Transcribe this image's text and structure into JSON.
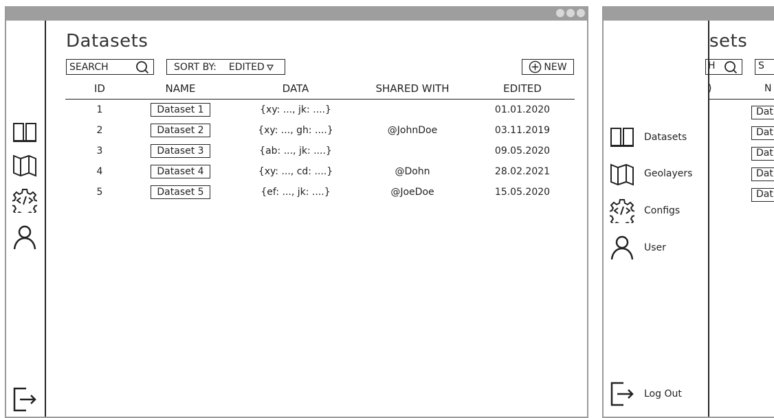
{
  "window1": {
    "title": "Datasets",
    "search_placeholder": "SEARCH",
    "sort_label": "SORT BY:",
    "sort_value": "EDITED",
    "new_label": "NEW",
    "columns": [
      "ID",
      "NAME",
      "DATA",
      "SHARED WITH",
      "EDITED"
    ],
    "rows": [
      {
        "id": "1",
        "name": "Dataset 1",
        "data": "{xy: ..., jk: ....}",
        "shared": "",
        "edited": "01.01.2020"
      },
      {
        "id": "2",
        "name": "Dataset 2",
        "data": "{xy: ..., gh: ....}",
        "shared": "@JohnDoe",
        "edited": "03.11.2019"
      },
      {
        "id": "3",
        "name": "Dataset 3",
        "data": "{ab: ..., jk: ....}",
        "shared": "",
        "edited": "09.05.2020"
      },
      {
        "id": "4",
        "name": "Dataset 4",
        "data": "{xy: ..., cd: ....}",
        "shared": "@Dohn",
        "edited": "28.02.2021"
      },
      {
        "id": "5",
        "name": "Dataset 5",
        "data": "{ef: ..., jk: ....}",
        "shared": "@JoeDoe",
        "edited": "15.05.2020"
      }
    ],
    "sidebar_icons": [
      "book-icon",
      "map-icon",
      "code-gear-icon",
      "user-icon"
    ],
    "logout_icon": "logout-icon"
  },
  "window2": {
    "title_fragment": "sets",
    "search_fragment": "H",
    "sort_fragment": "S",
    "id_col_fragment": ")",
    "name_col_fragment": "N",
    "row_fragments": [
      "Dat",
      "Dat",
      "Dat",
      "Dat",
      "Dat"
    ],
    "nav": [
      {
        "label": "Datasets",
        "icon": "book-icon"
      },
      {
        "label": "Geolayers",
        "icon": "map-icon"
      },
      {
        "label": "Configs",
        "icon": "code-gear-icon"
      },
      {
        "label": "User",
        "icon": "user-icon"
      }
    ],
    "logout_label": "Log Out"
  },
  "colors": {
    "titlebar": "#9e9e9e",
    "dots": "#d8d8d8",
    "ink": "#222222"
  }
}
